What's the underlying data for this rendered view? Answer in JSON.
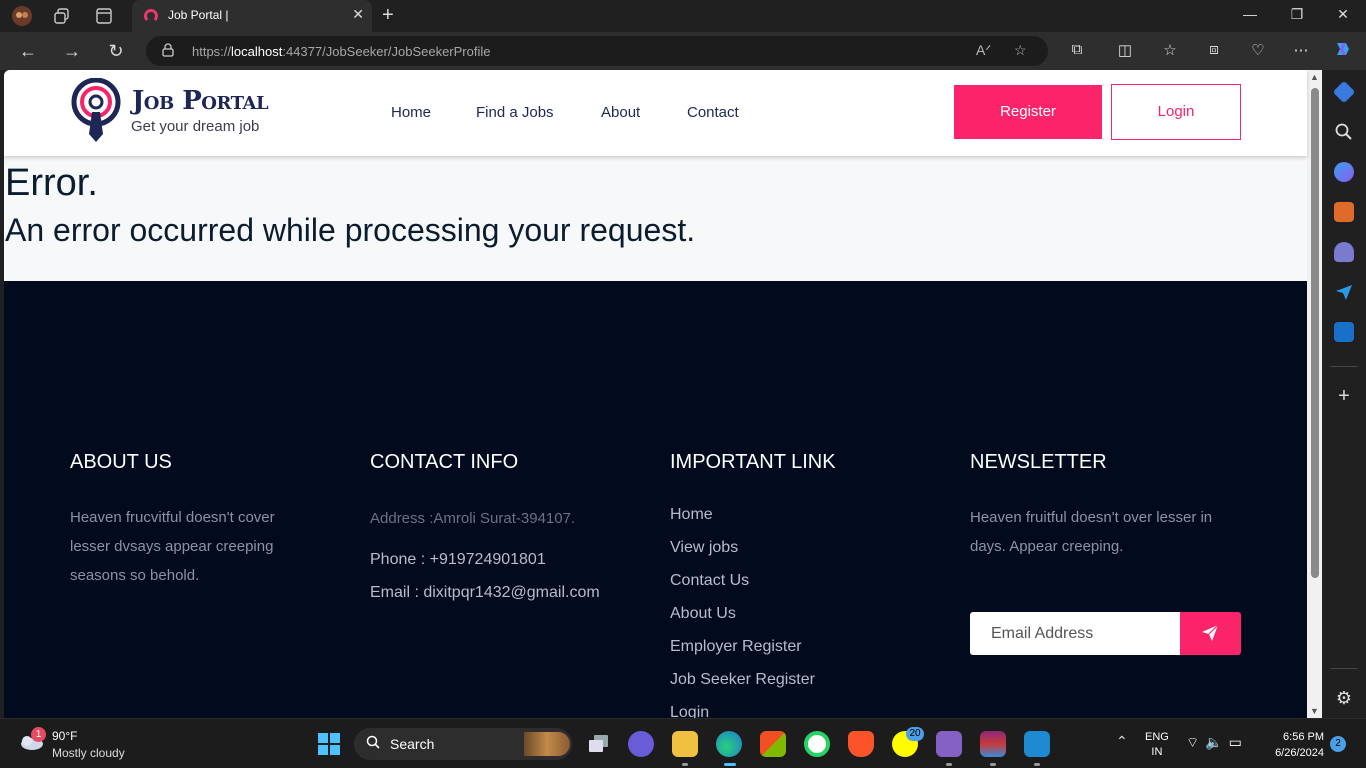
{
  "browser": {
    "tab_title": "Job Portal |",
    "url_prefix": "https://",
    "url_host": "localhost",
    "url_rest": ":44377/JobSeeker/JobSeekerProfile"
  },
  "header": {
    "logo_title": "Job Portal",
    "logo_tagline": "Get your dream job",
    "menu": [
      "Home",
      "Find a Jobs",
      "About",
      "Contact"
    ],
    "register_label": "Register",
    "login_label": "Login"
  },
  "error": {
    "title": "Error.",
    "message": "An error occurred while processing your request."
  },
  "footer": {
    "about_heading": "ABOUT US",
    "about_text": "Heaven frucvitful doesn't cover lesser dvsays appear creeping seasons so behold.",
    "contact_heading": "CONTACT INFO",
    "contact_address": "Address :Amroli Surat-394107.",
    "contact_phone": "Phone : +919724901801",
    "contact_email": "Email : dixitpqr1432@gmail.com",
    "links_heading": "IMPORTANT LINK",
    "links": [
      "Home",
      "View jobs",
      "Contact Us",
      "About Us",
      "Employer Register",
      "Job Seeker Register",
      "Login"
    ],
    "newsletter_heading": "NEWSLETTER",
    "newsletter_text": "Heaven fruitful doesn't over lesser in days. Appear creeping.",
    "newsletter_placeholder": "Email Address"
  },
  "taskbar": {
    "weather_temp": "90°F",
    "weather_desc": "Mostly cloudy",
    "weather_badge": "1",
    "search_label": "Search",
    "snapchat_badge": "20",
    "lang_line1": "ENG",
    "lang_line2": "IN",
    "time": "6:56 PM",
    "date": "6/26/2024",
    "notification_count": "2"
  },
  "colors": {
    "accent": "#fb246a",
    "navy": "#1e2656",
    "footer_bg": "#010b1d"
  }
}
